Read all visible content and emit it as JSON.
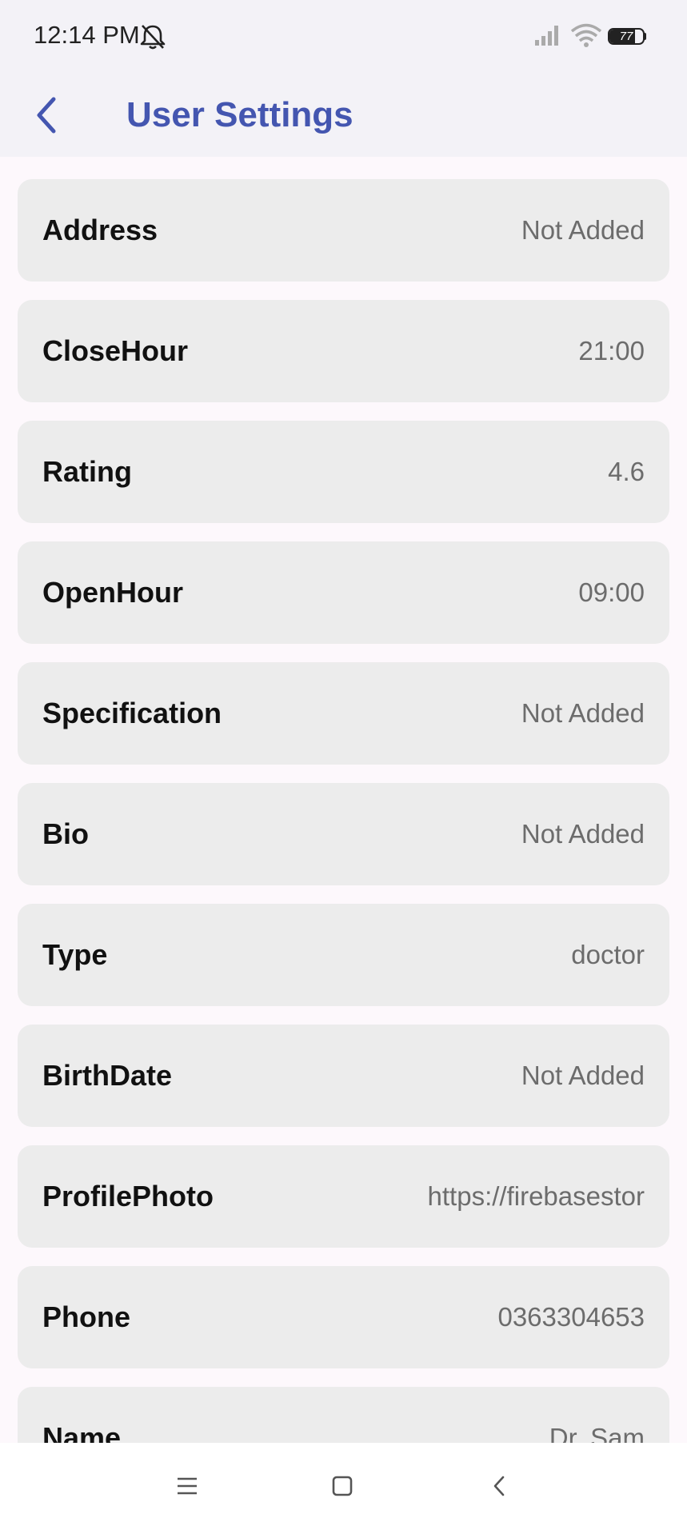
{
  "status_bar": {
    "time": "12:14 PM",
    "battery_level": "77",
    "icons": [
      "bell-off-icon",
      "signal-icon",
      "wifi-icon",
      "battery-icon"
    ]
  },
  "header": {
    "title": "User Settings",
    "back_icon": "chevron-left-icon",
    "accent_color": "#4456b0"
  },
  "settings": [
    {
      "label": "Address",
      "value": "Not Added"
    },
    {
      "label": "CloseHour",
      "value": "21:00"
    },
    {
      "label": "Rating",
      "value": "4.6"
    },
    {
      "label": "OpenHour",
      "value": "09:00"
    },
    {
      "label": "Specification",
      "value": "Not Added"
    },
    {
      "label": "Bio",
      "value": "Not Added"
    },
    {
      "label": "Type",
      "value": "doctor"
    },
    {
      "label": "BirthDate",
      "value": "Not Added"
    },
    {
      "label": "ProfilePhoto",
      "value": "https://firebasestor"
    },
    {
      "label": "Phone",
      "value": "0363304653"
    },
    {
      "label": "Name",
      "value": "Dr. Sam"
    }
  ],
  "nav_bar": {
    "icons": [
      "menu-icon",
      "home-square-icon",
      "back-triangle-icon"
    ]
  }
}
